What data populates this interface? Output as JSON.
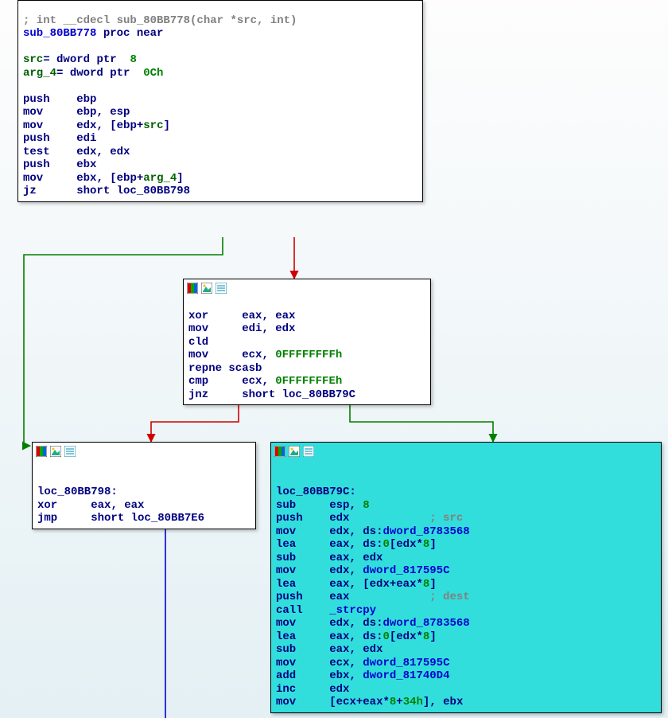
{
  "icons": {
    "asm": "asm-panel-icon",
    "img": "image-icon",
    "list": "list-icon"
  },
  "nodeA": {
    "l0": {
      "a": "; int __cdecl sub_80BB778(char *src, int)"
    },
    "l1": {
      "a": "sub_80BB778 ",
      "b": "proc near"
    },
    "l2": "",
    "l3a": "src",
    "l3b": "= ",
    "l3c": "dword ptr ",
    "l3d": " 8",
    "l4a": "arg_4",
    "l4b": "= ",
    "l4c": "dword ptr ",
    "l4d": " 0Ch",
    "l5": "",
    "l6a": "push",
    "l6b": "    ebp",
    "l7a": "mov",
    "l7b": "     ebp",
    "l7c": ", ",
    "l7d": "esp",
    "l8a": "mov",
    "l8b": "     edx",
    "l8c": ", [",
    "l8d": "ebp",
    "l8e": "+",
    "l8f": "src",
    "l8g": "]",
    "l9a": "push",
    "l9b": "    edi",
    "l10a": "test",
    "l10b": "    edx",
    "l10c": ", ",
    "l10d": "edx",
    "l11a": "push",
    "l11b": "    ebx",
    "l12a": "mov",
    "l12b": "     ebx",
    "l12c": ", [",
    "l12d": "ebp",
    "l12e": "+",
    "l12f": "arg_4",
    "l12g": "]",
    "l13a": "jz",
    "l13b": "      short loc_80BB798"
  },
  "nodeB": {
    "l0a": "xor",
    "l0b": "     eax",
    "l0c": ", ",
    "l0d": "eax",
    "l1a": "mov",
    "l1b": "     edi",
    "l1c": ", ",
    "l1d": "edx",
    "l2a": "cld",
    "l3a": "mov",
    "l3b": "     ecx",
    "l3c": ", ",
    "l3d": "0FFFFFFFFh",
    "l4a": "repne scasb",
    "l5a": "cmp",
    "l5b": "     ecx",
    "l5c": ", ",
    "l5d": "0FFFFFFFEh",
    "l6a": "jnz",
    "l6b": "     short loc_80BB79C"
  },
  "nodeC": {
    "l0": "",
    "l1a": "loc_80BB798",
    "l1b": ":",
    "l2a": "xor",
    "l2b": "     eax",
    "l2c": ", ",
    "l2d": "eax",
    "l3a": "jmp",
    "l3b": "     short loc_80BB7E6"
  },
  "nodeD": {
    "l0": "",
    "l1a": "loc_80BB79C",
    "l1b": ":",
    "l2a": "sub",
    "l2b": "     esp",
    "l2c": ", ",
    "l2d": "8",
    "l3a": "push",
    "l3b": "    edx",
    "l3c": "            ; src",
    "l4a": "mov",
    "l4b": "     edx",
    "l4c": ", ",
    "l4d": "ds",
    "l4e": ":",
    "l4f": "dword_8783568",
    "l5a": "lea",
    "l5b": "     eax",
    "l5c": ", ",
    "l5d": "ds",
    "l5e": ":",
    "l5f": "0",
    "l5g": "[",
    "l5h": "edx",
    "l5i": "*",
    "l5j": "8",
    "l5k": "]",
    "l6a": "sub",
    "l6b": "     eax",
    "l6c": ", ",
    "l6d": "edx",
    "l7a": "mov",
    "l7b": "     edx",
    "l7c": ", ",
    "l7d": "dword_817595C",
    "l8a": "lea",
    "l8b": "     eax",
    "l8c": ", [",
    "l8d": "edx",
    "l8e": "+",
    "l8f": "eax",
    "l8g": "*",
    "l8h": "8",
    "l8i": "]",
    "l9a": "push",
    "l9b": "    eax",
    "l9c": "            ; dest",
    "l10a": "call",
    "l10b": "    ",
    "l10c": "_strcpy",
    "l11a": "mov",
    "l11b": "     edx",
    "l11c": ", ",
    "l11d": "ds",
    "l11e": ":",
    "l11f": "dword_8783568",
    "l12a": "lea",
    "l12b": "     eax",
    "l12c": ", ",
    "l12d": "ds",
    "l12e": ":",
    "l12f": "0",
    "l12g": "[",
    "l12h": "edx",
    "l12i": "*",
    "l12j": "8",
    "l12k": "]",
    "l13a": "sub",
    "l13b": "     eax",
    "l13c": ", ",
    "l13d": "edx",
    "l14a": "mov",
    "l14b": "     ecx",
    "l14c": ", ",
    "l14d": "dword_817595C",
    "l15a": "add",
    "l15b": "     ebx",
    "l15c": ", ",
    "l15d": "dword_81740D4",
    "l16a": "inc",
    "l16b": "     edx",
    "l17a": "mov",
    "l17b": "     [",
    "l17c": "ecx",
    "l17d": "+",
    "l17e": "eax",
    "l17f": "*",
    "l17g": "8",
    "l17h": "+",
    "l17i": "34h",
    "l17j": "], ",
    "l17k": "ebx"
  }
}
